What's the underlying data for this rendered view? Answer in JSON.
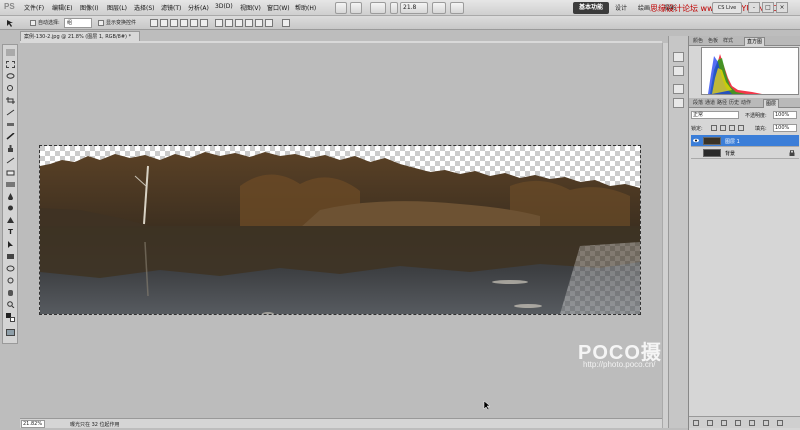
{
  "app": {
    "logo_text": "PS",
    "menu": [
      "文件(F)",
      "编辑(E)",
      "图像(I)",
      "图层(L)",
      "选择(S)",
      "滤镜(T)",
      "分析(A)",
      "3D(D)",
      "视图(V)",
      "窗口(W)",
      "帮助(H)"
    ],
    "zoom_level_menu": "21.8",
    "workspace_active": "基本功能",
    "workspace_labels": [
      "设计",
      "绘画",
      "摄影"
    ],
    "watermark_top": "思缘设计论坛 www.MISSYUAN.COM",
    "cslive_label": "CS Live",
    "window_controls": [
      "-",
      "□",
      "×"
    ]
  },
  "options_bar": {
    "auto_select_label": "自动选择:",
    "auto_select_value": "组",
    "show_transform_label": "显示变换控件"
  },
  "document": {
    "tab_title": "案例-130-2.jpg @ 21.8% (图层 1, RGB/8#) *",
    "watermark_logo": "POCO摄影专题",
    "watermark_url": "http://photo.poco.cn/"
  },
  "status_bar": {
    "zoom_value": "21.82%",
    "info_text": "曝光只在 32 位起作用"
  },
  "panels": {
    "top_tabs": [
      "颜色",
      "色板",
      "样式",
      "直方图"
    ],
    "top_active": "直方图",
    "layer_tabs": [
      "图层",
      "通道",
      "路径",
      "历史",
      "动作",
      "段落"
    ],
    "layer_active": "图层",
    "blend_mode": "正常",
    "opacity_label": "不透明度:",
    "opacity_value": "100%",
    "lock_label": "锁定:",
    "fill_label": "填充:",
    "fill_value": "100%",
    "layers": [
      {
        "name": "图层 1",
        "selected": true
      },
      {
        "name": "背景",
        "selected": false
      }
    ]
  },
  "colors": {
    "accent_selected_layer": "#3b7ed8",
    "workspace_button": "#3b3b3b",
    "watermark_red": "#c00000"
  }
}
